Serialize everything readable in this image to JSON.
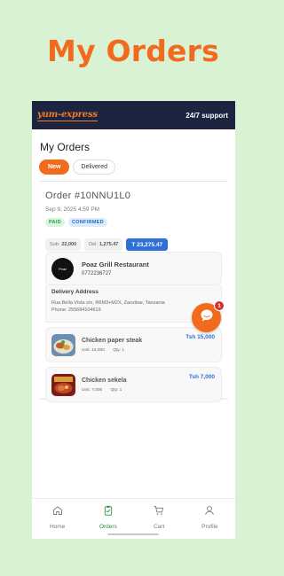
{
  "promo": {
    "title": "My Orders"
  },
  "app": {
    "logo_text": "yum-express",
    "support_label": "24/7 support",
    "page_title": "My Orders"
  },
  "tabs": [
    {
      "label": "New",
      "active": true
    },
    {
      "label": "Delivered",
      "active": false
    }
  ],
  "order": {
    "number": "Order #10NNU1L0",
    "date": "Sep 9, 2025 4:59 PM",
    "badges": {
      "paid": "PAID",
      "confirmed": "CONFIRMED"
    },
    "totals": {
      "sub_label": "Sub:",
      "sub_value": "22,000",
      "del_label": "Del:",
      "del_value": "1,275.47",
      "grand": "T 23,275.47"
    },
    "restaurant": {
      "name": "Poaz Grill Restaurant",
      "phone": "0772236727",
      "logo_text": "Poaz"
    },
    "delivery": {
      "label": "Delivery Address",
      "address": "Rua Bella Vista s/n, R6M3+M2X, Zanzibar, Tanzania",
      "phone": "Phone: 255684104619"
    },
    "items": [
      {
        "name": "Chicken paper steak",
        "unit": "Unit: 15,000",
        "qty": "Qty: 1",
        "price": "Tsh 15,000"
      },
      {
        "name": "Chicken sekela",
        "unit": "Unit: 7,000",
        "qty": "Qty: 1",
        "price": "Tsh 7,000"
      }
    ]
  },
  "chat": {
    "badge_count": "1"
  },
  "nav": [
    {
      "label": "Home",
      "icon": "home-icon"
    },
    {
      "label": "Orders",
      "icon": "clipboard-icon",
      "active": true
    },
    {
      "label": "Cart",
      "icon": "cart-icon"
    },
    {
      "label": "Profile",
      "icon": "user-icon"
    }
  ],
  "colors": {
    "background": "#d9f2d4",
    "accent": "#f26b1d",
    "header": "#1c2440",
    "link_blue": "#2f6fd8",
    "active_nav": "#2e8b3e"
  }
}
